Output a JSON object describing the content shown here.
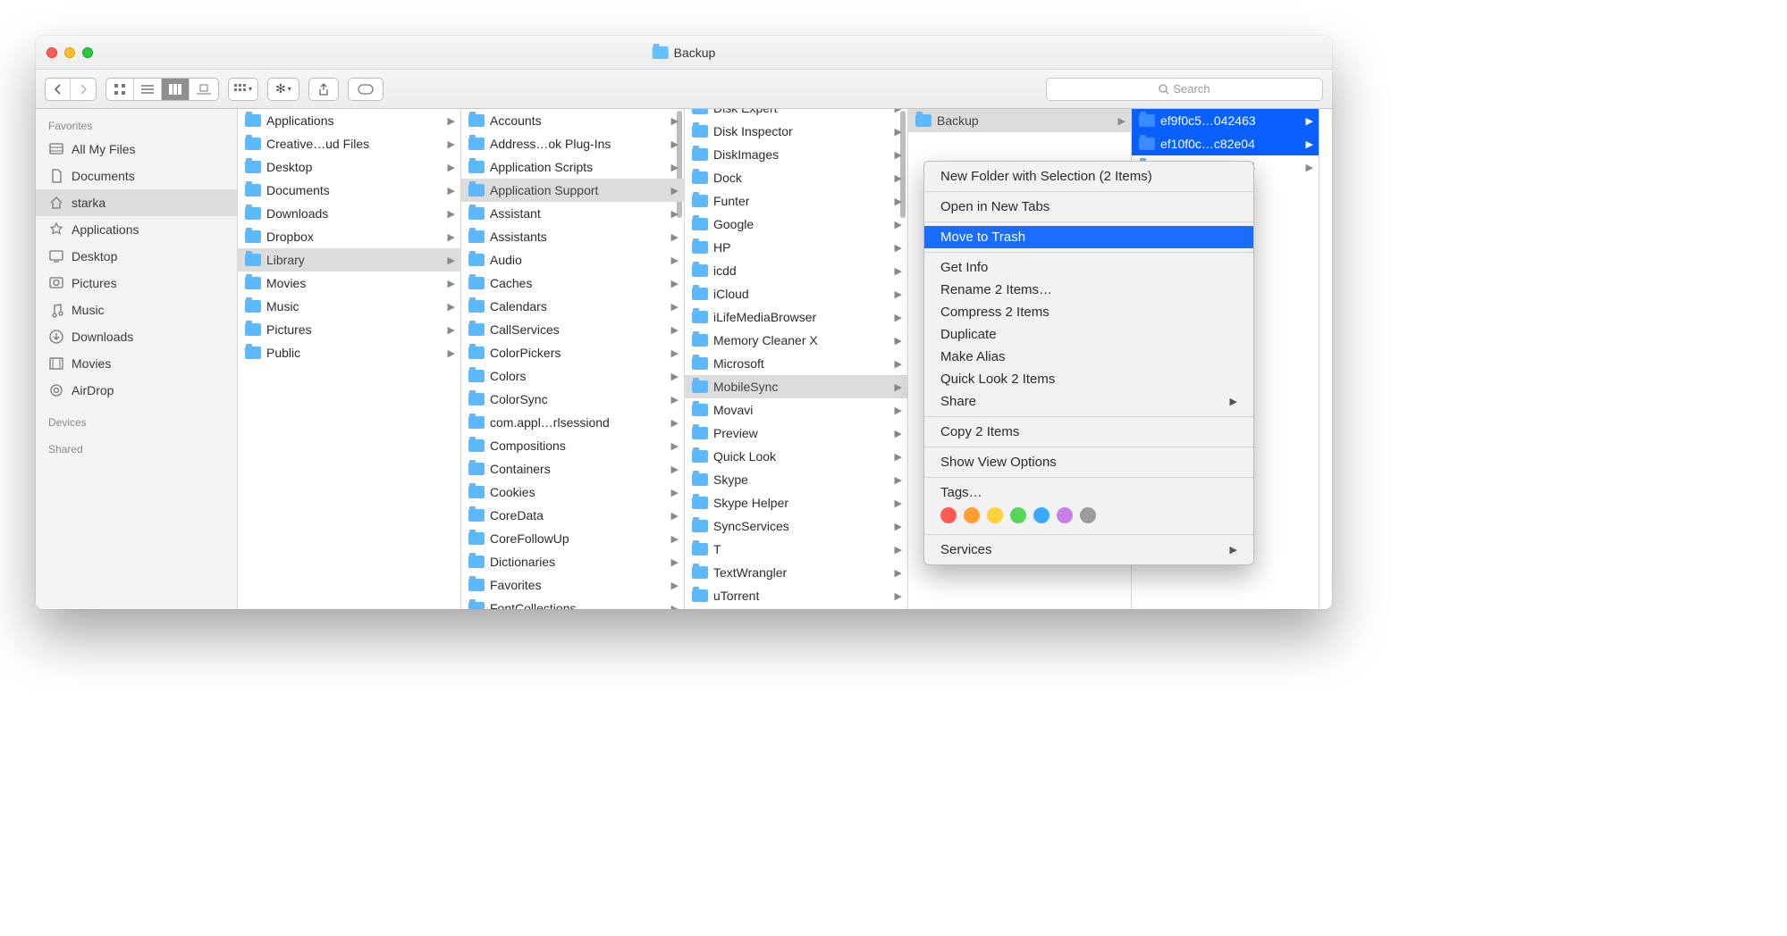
{
  "window": {
    "title": "Backup"
  },
  "toolbar": {
    "search_placeholder": "Search"
  },
  "sidebar": {
    "sections": {
      "favorites": "Favorites",
      "devices": "Devices",
      "shared": "Shared"
    },
    "items": [
      {
        "label": "All My Files",
        "icon": "all-my-files"
      },
      {
        "label": "Documents",
        "icon": "documents"
      },
      {
        "label": "starka",
        "icon": "home",
        "selected": true
      },
      {
        "label": "Applications",
        "icon": "applications"
      },
      {
        "label": "Desktop",
        "icon": "desktop"
      },
      {
        "label": "Pictures",
        "icon": "pictures"
      },
      {
        "label": "Music",
        "icon": "music"
      },
      {
        "label": "Downloads",
        "icon": "downloads"
      },
      {
        "label": "Movies",
        "icon": "movies"
      },
      {
        "label": "AirDrop",
        "icon": "airdrop"
      }
    ]
  },
  "columns": [
    {
      "selected": "Library",
      "items": [
        "Applications",
        "Creative…ud Files",
        "Desktop",
        "Documents",
        "Downloads",
        "Dropbox",
        "Library",
        "Movies",
        "Music",
        "Pictures",
        "Public"
      ]
    },
    {
      "selected": "Application Support",
      "scroll_indicator": true,
      "items": [
        "Accounts",
        "Address…ok Plug-Ins",
        "Application Scripts",
        "Application Support",
        "Assistant",
        "Assistants",
        "Audio",
        "Caches",
        "Calendars",
        "CallServices",
        "ColorPickers",
        "Colors",
        "ColorSync",
        "com.appl…rlsessiond",
        "Compositions",
        "Containers",
        "Cookies",
        "CoreData",
        "CoreFollowUp",
        "Dictionaries",
        "Favorites",
        "FontCollections"
      ]
    },
    {
      "selected": "MobileSync",
      "scroll_indicator": true,
      "offset": true,
      "items": [
        "Disk Expert",
        "Disk Inspector",
        "DiskImages",
        "Dock",
        "Funter",
        "Google",
        "HP",
        "icdd",
        "iCloud",
        "iLifeMediaBrowser",
        "Memory Cleaner X",
        "Microsoft",
        "MobileSync",
        "Movavi",
        "Preview",
        "Quick Look",
        "Skype",
        "Skype Helper",
        "SyncServices",
        "T",
        "TextWrangler",
        "uTorrent"
      ]
    },
    {
      "selected": "Backup",
      "items": [
        "Backup"
      ]
    },
    {
      "multi_selected": [
        "ef9f0c5…042463",
        "ef10f0c…c82e04"
      ],
      "items": [
        "ef9f0c5…042463",
        "ef10f0c…c82e04",
        "ef10f0c…c82e05"
      ]
    }
  ],
  "context_menu": {
    "highlighted": "Move to Trash",
    "groups": [
      [
        "New Folder with Selection (2 Items)"
      ],
      [
        "Open in New Tabs"
      ],
      [
        "Move to Trash"
      ],
      [
        "Get Info",
        "Rename 2 Items…",
        "Compress 2 Items",
        "Duplicate",
        "Make Alias",
        "Quick Look 2 Items",
        {
          "label": "Share",
          "arrow": true
        }
      ],
      [
        "Copy 2 Items"
      ],
      [
        "Show View Options"
      ],
      [
        "Tags…"
      ],
      [
        {
          "label": "Services",
          "arrow": true
        }
      ]
    ],
    "tag_colors": [
      "#ff5b52",
      "#ff9d33",
      "#ffd23b",
      "#58d558",
      "#3ba8ff",
      "#c97fe4",
      "#9b9b9b"
    ]
  }
}
